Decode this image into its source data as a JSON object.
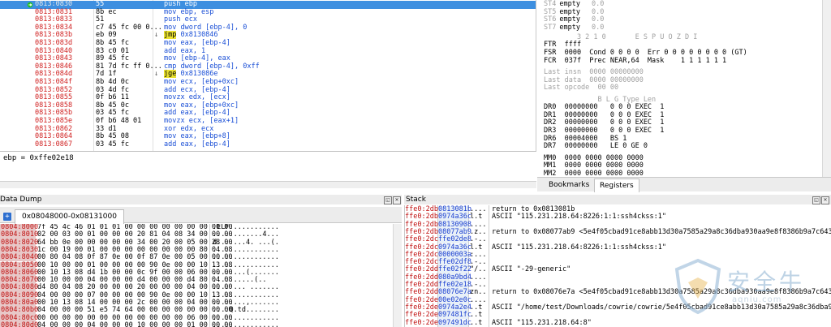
{
  "disasm": {
    "rows": [
      {
        "addr": "0813:0830",
        "bytes": "55",
        "mark": "",
        "instr": "push ebp",
        "sel": true
      },
      {
        "addr": "0813:0831",
        "bytes": "8b ec",
        "mark": "",
        "instr": "mov ebp, esp"
      },
      {
        "addr": "0813:0833",
        "bytes": "51",
        "mark": "",
        "instr": "push ecx"
      },
      {
        "addr": "0813:0834",
        "bytes": "c7 45 fc 00 0...",
        "mark": "",
        "instr": "mov dword [ebp-4], 0"
      },
      {
        "addr": "0813:083b",
        "bytes": "eb 09",
        "mark": "↓",
        "instr": "jmp 0x8130846",
        "hl": "jmp"
      },
      {
        "addr": "0813:083d",
        "bytes": "8b 45 fc",
        "mark": "",
        "instr": "mov eax, [ebp-4]"
      },
      {
        "addr": "0813:0840",
        "bytes": "83 c0 01",
        "mark": "",
        "instr": "add eax, 1"
      },
      {
        "addr": "0813:0843",
        "bytes": "89 45 fc",
        "mark": "",
        "instr": "mov [ebp-4], eax"
      },
      {
        "addr": "0813:0846",
        "bytes": "81 7d fc ff 0...",
        "mark": "",
        "instr": "cmp dword [ebp-4], 0xff"
      },
      {
        "addr": "0813:084d",
        "bytes": "7d 1f",
        "mark": "↓",
        "instr": "jge 0x813086e",
        "hl": "jge"
      },
      {
        "addr": "0813:084f",
        "bytes": "8b 4d 0c",
        "mark": "",
        "instr": "mov ecx, [ebp+0xc]"
      },
      {
        "addr": "0813:0852",
        "bytes": "03 4d fc",
        "mark": "",
        "instr": "add ecx, [ebp-4]"
      },
      {
        "addr": "0813:0855",
        "bytes": "0f b6 11",
        "mark": "",
        "instr": "movzx edx, [ecx]"
      },
      {
        "addr": "0813:0858",
        "bytes": "8b 45 0c",
        "mark": "",
        "instr": "mov eax, [ebp+0xc]"
      },
      {
        "addr": "0813:085b",
        "bytes": "03 45 fc",
        "mark": "",
        "instr": "add eax, [ebp-4]"
      },
      {
        "addr": "0813:085e",
        "bytes": "0f b6 48 01",
        "mark": "",
        "instr": "movzx ecx, [eax+1]"
      },
      {
        "addr": "0813:0862",
        "bytes": "33 d1",
        "mark": "",
        "instr": "xor edx, ecx"
      },
      {
        "addr": "0813:0864",
        "bytes": "8b 45 08",
        "mark": "",
        "instr": "mov eax, [ebp+8]"
      },
      {
        "addr": "0813:0867",
        "bytes": "03 45 fc",
        "mark": "",
        "instr": "add eax, [ebp-4]"
      }
    ]
  },
  "info": {
    "text": "ebp = 0xffe02e18"
  },
  "fpu": {
    "rows": [
      {
        "a": "ST4",
        "b": "empty",
        "c": "0.0"
      },
      {
        "a": "ST5",
        "b": "empty",
        "c": "0.0"
      },
      {
        "a": "ST6",
        "b": "empty",
        "c": "0.0"
      },
      {
        "a": "ST7",
        "b": "empty",
        "c": "0.0"
      }
    ],
    "flags_header": "        3 2 1 0       E S P U O Z D I",
    "ftr": "FTR  ffff",
    "fsr": "FSR  0000  Cond 0 0 0 0  Err 0 0 0 0 0 0 0 0 (GT)",
    "fcr": "FCR  037f  Prec NEAR,64  Mask    1 1 1 1 1 1",
    "last_insn": "Last insn  0000 00000000",
    "last_data": "Last data  0000 00000000",
    "last_opcode": "Last opcode  00 00",
    "dr_header": "             B L G Type Len",
    "dr": [
      "DR0  00000000   0 0 0 EXEC  1",
      "DR1  00000000   0 0 0 EXEC  1",
      "DR2  00000000   0 0 0 EXEC  1",
      "DR3  00000000   0 0 0 EXEC  1",
      "DR6  00004000   BS 1",
      "DR7  00000000   LE 0 GE 0"
    ],
    "mm": [
      "MM0  0000 0000 0000 0000",
      "MM1  0000 0000 0000 0000",
      "MM2  0000 0000 0000 0000",
      "MM3  0000 0000 0000 0000"
    ]
  },
  "right_tabs": {
    "bookmarks": "Bookmarks",
    "registers": "Registers"
  },
  "dump": {
    "title": "Data Dump",
    "tab": "0x08048000-0x08131000",
    "rows": [
      {
        "addr": "0804:8000",
        "hex": "7f 45 4c 46 01 01 01 00 00 00 00 00 00 00 00 00",
        "ascii": ".ELF............"
      },
      {
        "addr": "0804:8010",
        "hex": "02 00 03 00 01 00 00 00 20 81 04 08 34 00 00 00",
        "ascii": "............4..."
      },
      {
        "addr": "0804:8020",
        "hex": "64 bb 0e 00 00 00 00 00 34 00 20 00 05 00 28 00",
        "ascii": "d.......4. ...(."
      },
      {
        "addr": "0804:8030",
        "hex": "1c 00 19 00 01 00 00 00 00 00 00 00 00 80 04 08",
        "ascii": "................"
      },
      {
        "addr": "0804:8040",
        "hex": "00 80 04 08 0f 87 0e 00 0f 87 0e 00 05 00 00 00",
        "ascii": "................"
      },
      {
        "addr": "0804:8050",
        "hex": "00 10 00 00 01 00 00 00 00 90 0e 00 00 10 13 08",
        "ascii": "................"
      },
      {
        "addr": "0804:8060",
        "hex": "00 10 13 08 d4 1b 00 00 0c 9f 00 00 06 00 00 00",
        "ascii": "........(......."
      },
      {
        "addr": "0804:8070",
        "hex": "00 10 00 00 04 00 00 00 d4 00 00 00 d4 80 04 08",
        "ascii": "..........(.."
      },
      {
        "addr": "0804:8080",
        "hex": "d4 80 04 08 20 00 00 00 20 00 00 00 04 00 00 00",
        "ascii": ".... ... ......."
      },
      {
        "addr": "0804:8090",
        "hex": "04 00 00 00 07 00 00 00 00 90 0e 00 00 10 13 08",
        "ascii": "................"
      },
      {
        "addr": "0804:80a0",
        "hex": "00 10 13 08 14 00 00 00 2c 00 00 00 04 00 00 00",
        "ascii": "........,......."
      },
      {
        "addr": "0804:80b0",
        "hex": "04 00 00 00 51 e5 74 64 00 00 00 00 00 00 00 00",
        "ascii": "....Q.td........"
      },
      {
        "addr": "0804:80c0",
        "hex": "00 00 00 00 00 00 00 00 00 00 00 00 06 00 00 00",
        "ascii": "................"
      },
      {
        "addr": "0804:80d0",
        "hex": "04 00 00 00 04 00 00 00 10 00 00 00 01 00 00 00",
        "ascii": "................"
      }
    ]
  },
  "stack": {
    "title": "Stack",
    "rows": [
      {
        "addr": "ffe0:2db0",
        "val": "0813081b",
        "asc": "....",
        "com": "return to 0x0813081b"
      },
      {
        "addr": "ffe0:2db4",
        "val": "0974a36c",
        "asc": "l.t",
        "com": "ASCII \"115.231.218.64:8226:1:1:ssh4ckss:1\""
      },
      {
        "addr": "ffe0:2db8",
        "val": "08130908",
        "asc": "....",
        "com": ""
      },
      {
        "addr": "ffe0:2dbc",
        "val": "08077ab9",
        "asc": ".z..",
        "com": "return to 0x08077ab9 <5e4f05cbad91ce8abb13d30a7585a29a8c36dba930aa9e8f8386b9a7c6436b12!CSy"
      },
      {
        "addr": "ffe0:2dc0",
        "val": "ffe02de8",
        "asc": ".-..",
        "com": ""
      },
      {
        "addr": "ffe0:2dc4",
        "val": "0974a36c",
        "asc": "l.t",
        "com": "ASCII \"115.231.218.64:8226:1:1:ssh4ckss:1\""
      },
      {
        "addr": "ffe0:2dc8",
        "val": "0000003a",
        "asc": ":...",
        "com": ""
      },
      {
        "addr": "ffe0:2dcc",
        "val": "ffe02df8",
        "asc": ".-..",
        "com": ""
      },
      {
        "addr": "ffe0:2dd0",
        "val": "ffe02f22",
        "asc": "\"/..",
        "com": "ASCII \"-29-generic\""
      },
      {
        "addr": "ffe0:2dd4",
        "val": "080a9bd4",
        "asc": "....",
        "com": ""
      },
      {
        "addr": "ffe0:2dd8",
        "val": "ffe02e18",
        "asc": ".-..",
        "com": ""
      },
      {
        "addr": "ffe0:2ddc",
        "val": "08076e7a",
        "asc": "zn..",
        "com": "return to 0x08076e7a <5e4f05cbad91ce8abb13d30a7585a29a8c36dba930aa9e8f8386b9a7c6436b12!CSy"
      },
      {
        "addr": "ffe0:2de0",
        "val": "00e02e0c",
        "asc": "....",
        "com": ""
      },
      {
        "addr": "ffe0:2de4",
        "val": "0974a2e4",
        "asc": "..t",
        "com": "ASCII \"/home/test/Downloads/cowrie/cowrie/5e4f05cbad91ce8abb13d30a7585a29a8c36dba930aa9e8f\""
      },
      {
        "addr": "ffe0:2de8",
        "val": "097481fc",
        "asc": "..t",
        "com": ""
      },
      {
        "addr": "ffe0:2dec",
        "val": "097491dc",
        "asc": "..t",
        "com": "ASCII \"115.231.218.64:8\""
      }
    ]
  },
  "watermark": {
    "text": "安全牛",
    "url": "aqniu.com"
  }
}
